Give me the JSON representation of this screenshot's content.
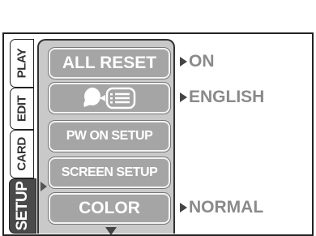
{
  "tabs": [
    {
      "label": "PLAY"
    },
    {
      "label": "EDIT"
    },
    {
      "label": "CARD"
    },
    {
      "label": "SETUP"
    }
  ],
  "menu": [
    {
      "label": "ALL RESET",
      "value": "ON"
    },
    {
      "label": "",
      "icon": "language-icon",
      "value": "ENGLISH"
    },
    {
      "label": "PW ON SETUP",
      "value": ""
    },
    {
      "label": "SCREEN SETUP",
      "value": ""
    },
    {
      "label": "COLOR",
      "value": "NORMAL"
    }
  ]
}
